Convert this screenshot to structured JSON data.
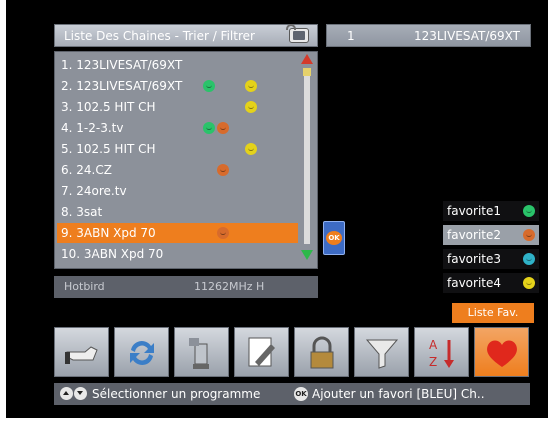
{
  "header": {
    "title": "Liste Des Chaines - Trier / Filtrer",
    "channel_number": "1",
    "channel_name": "123LIVESAT/69XT"
  },
  "channels": [
    {
      "label": "1. 123LIVESAT/69XT",
      "selected": false,
      "dots": []
    },
    {
      "label": "2. 123LIVESAT/69XT",
      "selected": false,
      "dots": [
        "green",
        "yellow"
      ]
    },
    {
      "label": "3. 102.5 HIT CH",
      "selected": false,
      "dots": [
        "yellow"
      ]
    },
    {
      "label": "4. 1-2-3.tv",
      "selected": false,
      "dots": [
        "green",
        "orange"
      ]
    },
    {
      "label": "5. 102.5 HIT CH",
      "selected": false,
      "dots": [
        "yellow"
      ]
    },
    {
      "label": "6. 24.CZ",
      "selected": false,
      "dots": [
        "orange"
      ]
    },
    {
      "label": "7. 24ore.tv",
      "selected": false,
      "dots": []
    },
    {
      "label": "8. 3sat",
      "selected": false,
      "dots": []
    },
    {
      "label": "9. 3ABN Xpd 70",
      "selected": true,
      "dots": [
        "orange"
      ]
    },
    {
      "label": "10. 3ABN Xpd 70",
      "selected": false,
      "dots": []
    }
  ],
  "status": {
    "satellite": "Hotbird",
    "frequency": "11262MHz H"
  },
  "ok_label": "OK",
  "favorites": [
    {
      "label": "favorite1",
      "color": "green"
    },
    {
      "label": "favorite2",
      "color": "orange",
      "selected": true
    },
    {
      "label": "favorite3",
      "color": "cyan"
    },
    {
      "label": "favorite4",
      "color": "yellow"
    }
  ],
  "fav_list_button": "Liste Fav.",
  "toolbar_icons": [
    "hand-icon",
    "refresh-icon",
    "satellite-dish-icon",
    "edit-icon",
    "lock-icon",
    "filter-icon",
    "sort-az-icon",
    "heart-icon"
  ],
  "footer": {
    "hint_select": "Sélectionner un programme",
    "ok_small": "OK",
    "hint_add": "Ajouter un favori [BLEU] Ch.."
  },
  "colors": {
    "accent": "#ee7e1e",
    "panel": "#8c919a",
    "green": "#2ac36a",
    "yellow": "#e4d21a",
    "orange": "#d76b2c",
    "cyan": "#2fb2c8"
  }
}
